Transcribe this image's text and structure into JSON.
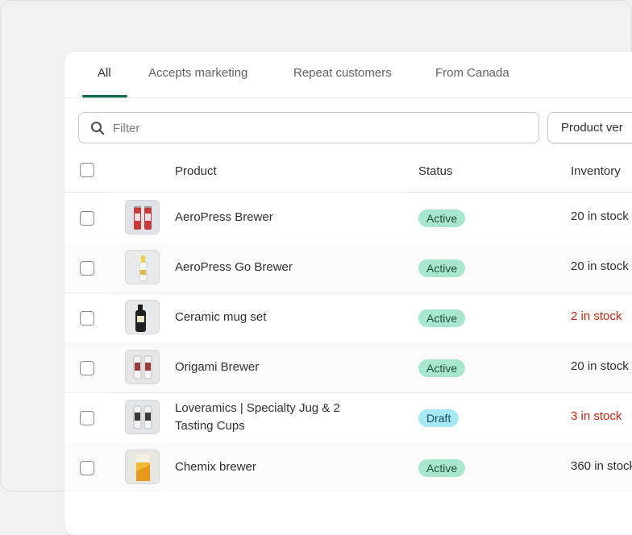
{
  "tabs": [
    {
      "label": "All",
      "active": true
    },
    {
      "label": "Accepts marketing",
      "active": false
    },
    {
      "label": "Repeat customers",
      "active": false
    },
    {
      "label": "From Canada",
      "active": false
    }
  ],
  "filter": {
    "placeholder": "Filter",
    "value": ""
  },
  "product_vendor_button": "Product ver",
  "columns": {
    "product": "Product",
    "status": "Status",
    "inventory": "Inventory"
  },
  "rows": [
    {
      "name": "AeroPress Brewer",
      "status": "Active",
      "inventory": "20 in stock",
      "low_stock": false,
      "thumb": "red-cans"
    },
    {
      "name": "AeroPress Go Brewer",
      "status": "Active",
      "inventory": "20 in stock",
      "low_stock": false,
      "thumb": "clear-bottle"
    },
    {
      "name": "Ceramic mug set",
      "status": "Active",
      "inventory": "2 in stock",
      "low_stock": true,
      "thumb": "dark-bottle"
    },
    {
      "name": "Origami Brewer",
      "status": "Active",
      "inventory": "20 in stock",
      "low_stock": false,
      "thumb": "white-cans"
    },
    {
      "name": "Loveramics | Specialty Jug & 2 Tasting Cups",
      "name_line1": "Loveramics | Specialty Jug & 2",
      "name_line2": "Tasting Cups",
      "status": "Draft",
      "inventory": "3 in stock",
      "low_stock": true,
      "thumb": "white-cans-2"
    },
    {
      "name": "Chemix brewer",
      "status": "Active",
      "inventory": "360 in stock",
      "low_stock": false,
      "thumb": "yellow-can"
    }
  ],
  "colors": {
    "active_badge": "#a8e6cf",
    "draft_badge": "#a6e9f5",
    "low_stock_text": "#c5280c",
    "tab_underline": "#0e6b53"
  }
}
